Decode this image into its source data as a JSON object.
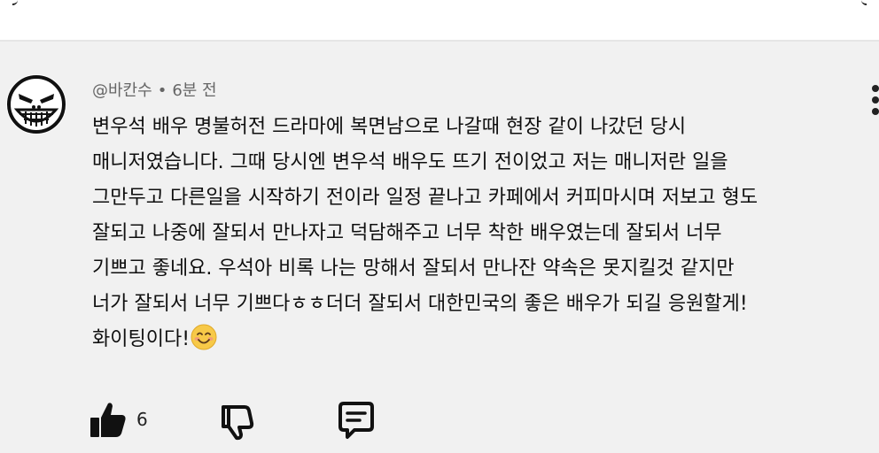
{
  "comment": {
    "author": "@바칸수",
    "separator": "•",
    "time": "6분 전",
    "lines": [
      "변우석 배우 명불허전 드라마에 복면남으로 나갈때 현장 같이 나갔던 당시",
      "매니저였습니다. 그때 당시엔 변우석 배우도 뜨기 전이었고 저는 매니저란 일을",
      "그만두고 다른일을 시작하기 전이라 일정 끝나고 카페에서 커피마시며 저보고 형도",
      "잘되고 나중에 잘되서 만나자고 덕담해주고 너무 착한 배우였는데 잘되서 너무",
      "기쁘고 좋네요. 우석아 비록 나는 망해서 잘되서 만나잔 약속은 못지킬것 같지만",
      "너가 잘되서 너무 기쁘다ㅎㅎ더더 잘되서 대한민국의 좋은 배우가 되길 응원할게!",
      "화이팅이다!"
    ],
    "emoji": "smiling-face-with-smiling-eyes"
  },
  "actions": {
    "like_count": "6",
    "icons": {
      "like": "thumbs-up-filled-icon",
      "dislike": "thumbs-down-outline-icon",
      "reply": "comment-reply-icon",
      "more": "more-vertical-icon"
    }
  },
  "colors": {
    "background": "#f1f1f1",
    "text": "#0f0f0f",
    "meta": "#666666",
    "emoji_face": "#f7c948"
  }
}
